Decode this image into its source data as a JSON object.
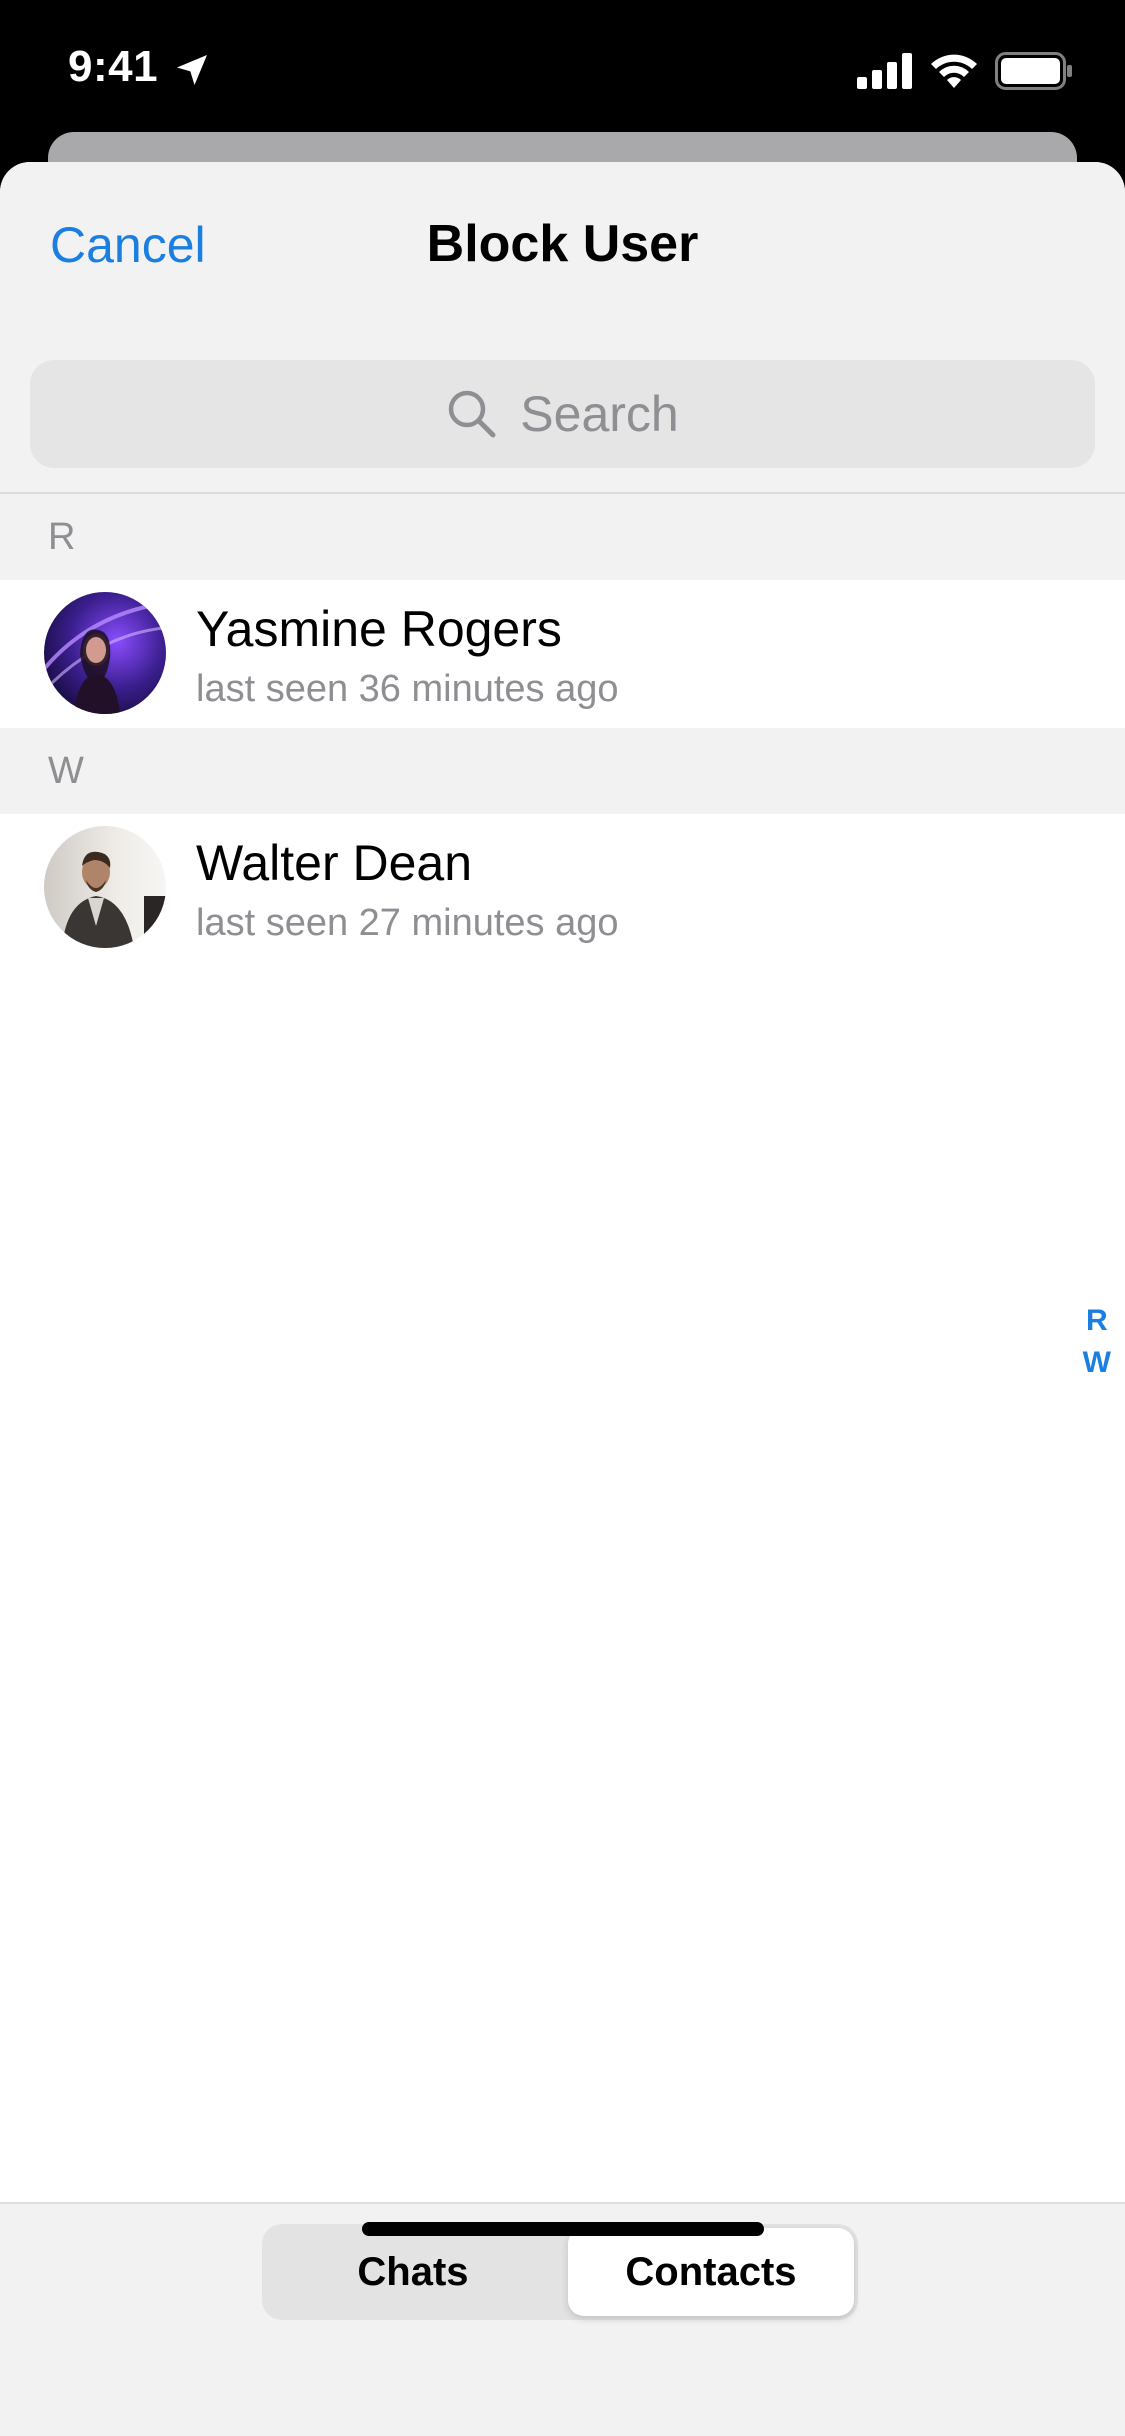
{
  "status_bar": {
    "time": "9:41",
    "icons": [
      "location-arrow-icon",
      "cellular-signal-icon",
      "wifi-icon",
      "battery-icon"
    ]
  },
  "nav": {
    "cancel_label": "Cancel",
    "title": "Block User"
  },
  "search": {
    "placeholder": "Search",
    "icon": "search-icon"
  },
  "sections": [
    {
      "letter": "R",
      "contacts": [
        {
          "name": "Yasmine Rogers",
          "status": "last seen 36 minutes ago"
        }
      ]
    },
    {
      "letter": "W",
      "contacts": [
        {
          "name": "Walter Dean",
          "status": "last seen 27 minutes ago"
        }
      ]
    }
  ],
  "index": [
    "R",
    "W"
  ],
  "segmented": {
    "chats_label": "Chats",
    "contacts_label": "Contacts",
    "selected": "Contacts"
  },
  "colors": {
    "accent": "#1a7fe0",
    "secondary_text": "#8e8e93",
    "grouped_background": "#f2f2f2"
  }
}
